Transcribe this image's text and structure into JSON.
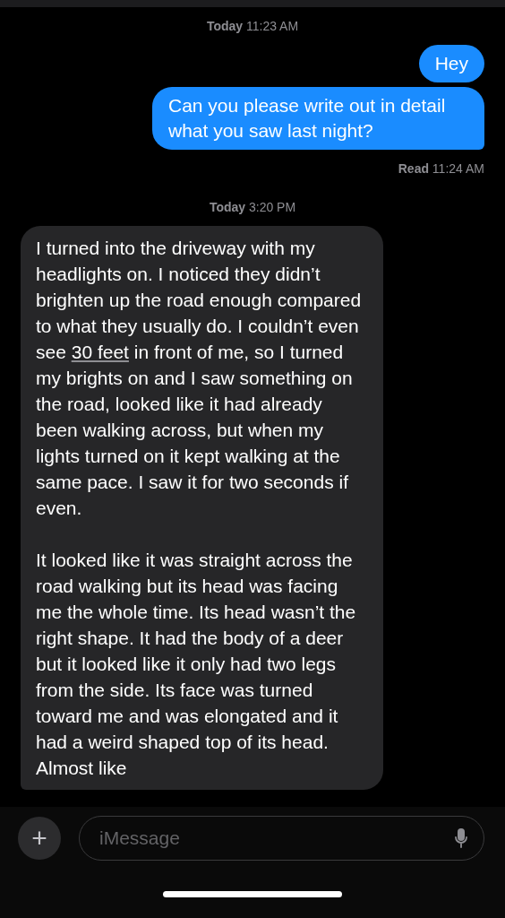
{
  "thread": [
    {
      "kind": "timestamp",
      "text": "**Today** 11:23 AM"
    },
    {
      "kind": "sent",
      "text": "Hey"
    },
    {
      "kind": "sent",
      "text": "Can you please write out in detail what you saw last night?"
    },
    {
      "kind": "receipt",
      "text": "**Read** 11:24 AM"
    },
    {
      "kind": "timestamp",
      "text": "**Today** 3:20 PM"
    },
    {
      "kind": "received",
      "paragraphs": [
        {
          "parts": [
            {
              "text": "I turned into the driveway with my headlights on. I noticed they didn’t brighten up the road enough compared to what they usually do. I couldn’t even see ",
              "kind": "text"
            },
            {
              "text": "30 feet",
              "kind": "link"
            },
            {
              "text": " in front of me, so I turned my brights on and I saw something on the road, looked like it had already been walking across, but when my lights turned on it kept walking at the same pace. I saw it for two seconds if even.",
              "kind": "text"
            }
          ]
        },
        {
          "parts": [
            {
              "text": "It looked like it was straight across the road walking but its head was facing me the whole time. Its head wasn’t the right shape. It had the body of a deer but it looked like it only had two legs from the side. Its face was turned toward me and was elongated and it had a weird shaped top of its head. Almost like",
              "kind": "text"
            }
          ]
        }
      ]
    }
  ],
  "composer": {
    "placeholder": "iMessage",
    "plus": "+"
  }
}
